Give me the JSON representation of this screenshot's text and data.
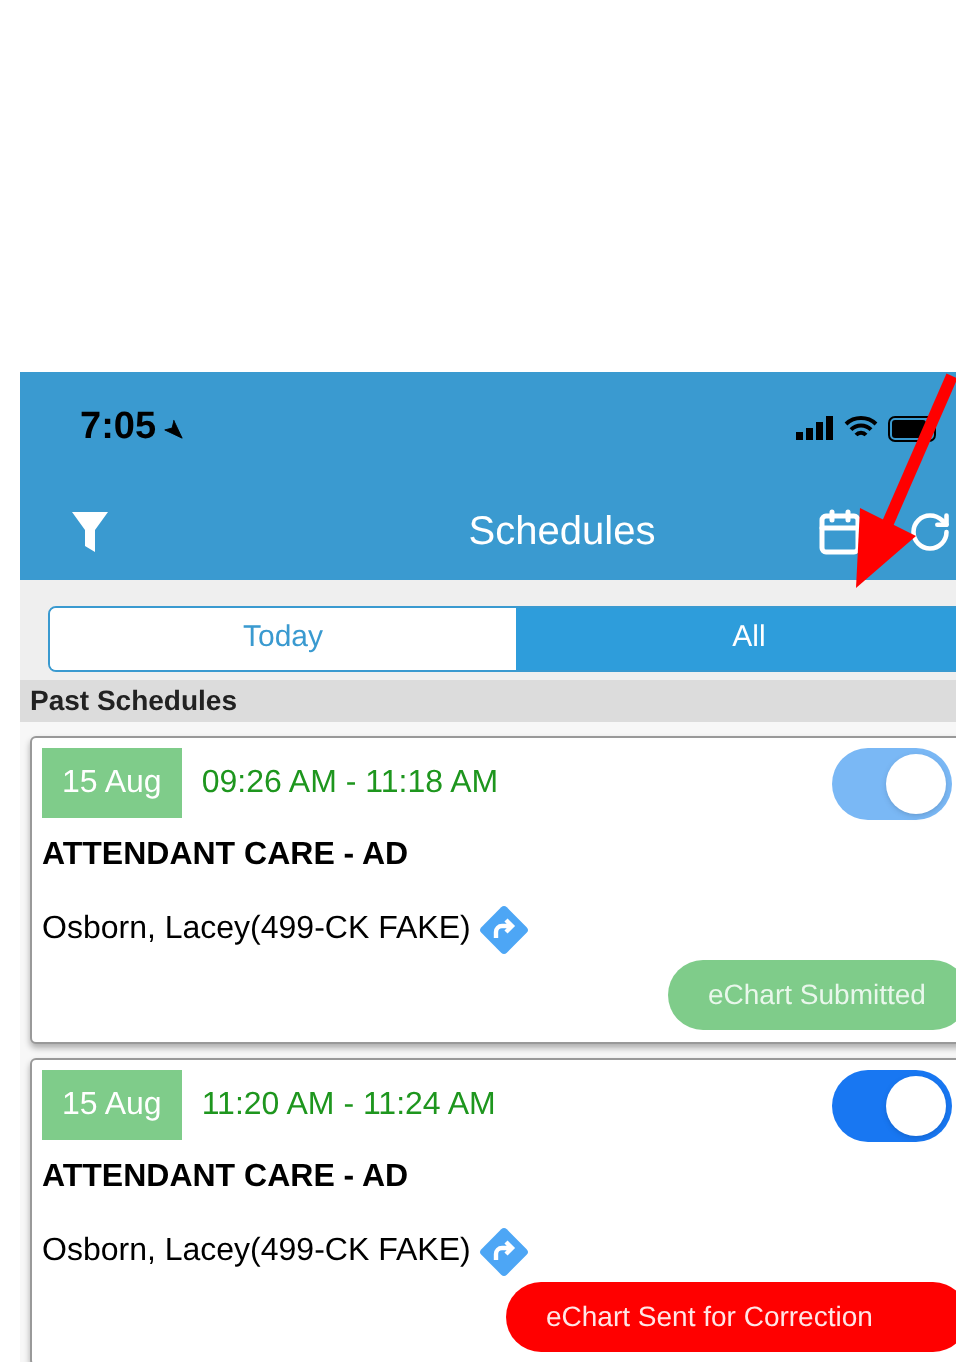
{
  "status_bar": {
    "time": "7:05"
  },
  "nav": {
    "title": "Schedules"
  },
  "tabs": [
    {
      "label": "Today",
      "selected": false
    },
    {
      "label": "All",
      "selected": true
    }
  ],
  "section": {
    "title": "Past Schedules"
  },
  "schedules": [
    {
      "date": "15 Aug",
      "time": "09:26 AM - 11:18 AM",
      "on": true,
      "disabled": true,
      "service": "ATTENDANT CARE - AD",
      "client": "Osborn, Lacey(499-CK FAKE)",
      "status": {
        "kind": "submitted",
        "label": "eChart Submitted"
      }
    },
    {
      "date": "15 Aug",
      "time": "11:20 AM - 11:24 AM",
      "on": true,
      "disabled": false,
      "service": "ATTENDANT CARE - AD",
      "client": "Osborn, Lacey(499-CK FAKE)",
      "status": {
        "kind": "correction",
        "label": "eChart Sent for Correction"
      }
    }
  ]
}
